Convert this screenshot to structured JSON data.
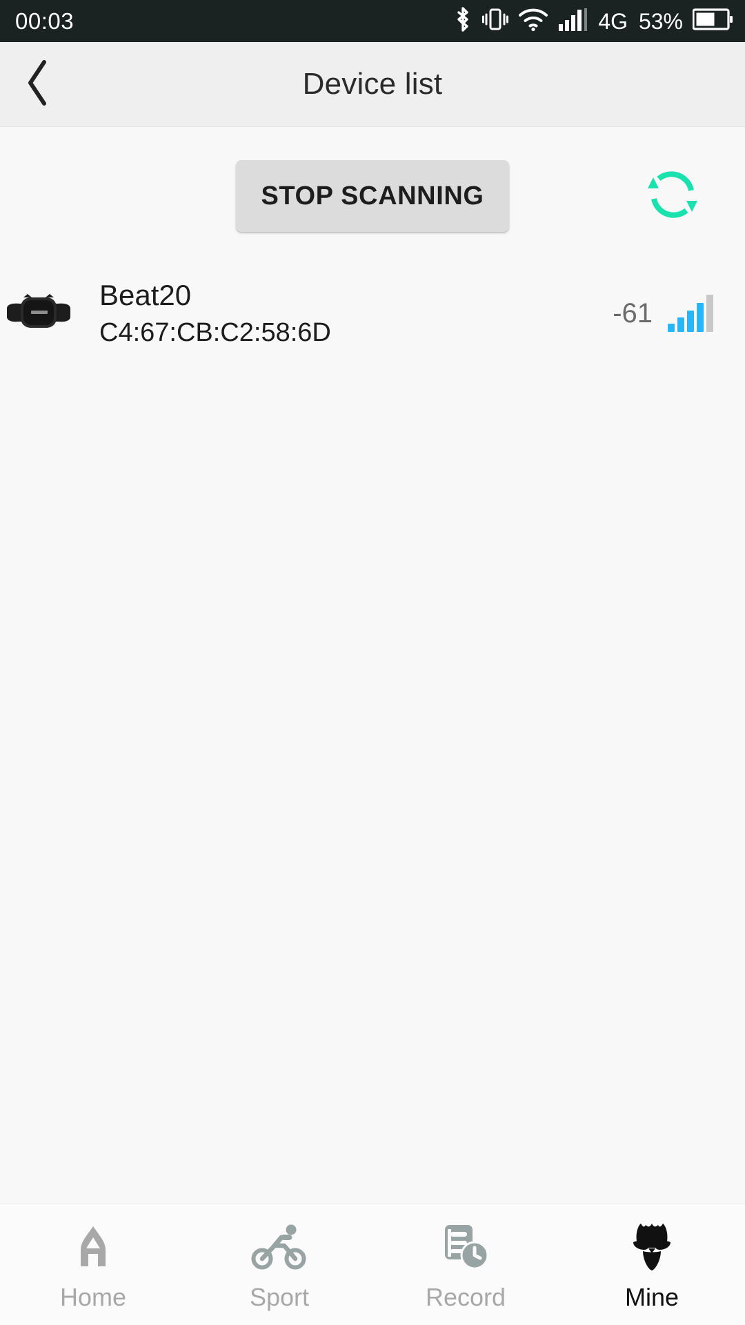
{
  "status_bar": {
    "clock": "00:03",
    "network_label": "4G",
    "battery_percent": "53%",
    "icons": [
      "bluetooth-icon",
      "vibrate-icon",
      "wifi-icon",
      "cellular-signal-icon",
      "battery-icon"
    ],
    "background_color": "#1b2222",
    "foreground_color": "#ffffff"
  },
  "header": {
    "title": "Device list",
    "back_icon": "chevron-left-icon",
    "background_color": "#efefef"
  },
  "scan": {
    "button_label": "STOP SCANNING",
    "button_color": "#dcdcdc",
    "refresh_icon": "refresh-icon",
    "refresh_color": "#19e2ae"
  },
  "devices": [
    {
      "name": "Beat20",
      "mac": "C4:67:CB:C2:58:6D",
      "rssi": "-61",
      "signal_bars_active": 4,
      "signal_bars_total": 5,
      "signal_color": "#29b6f6",
      "signal_inactive_color": "#c8c8c8",
      "thumbnail_icon": "chest-strap-device-icon"
    }
  ],
  "tabbar": {
    "items": [
      {
        "label": "Home",
        "icon": "home-icon",
        "active": false
      },
      {
        "label": "Sport",
        "icon": "cyclist-icon",
        "active": false
      },
      {
        "label": "Record",
        "icon": "record-clock-icon",
        "active": false
      },
      {
        "label": "Mine",
        "icon": "profile-icon",
        "active": true
      }
    ],
    "active_color": "#111111",
    "inactive_color": "#a8a8a8"
  }
}
